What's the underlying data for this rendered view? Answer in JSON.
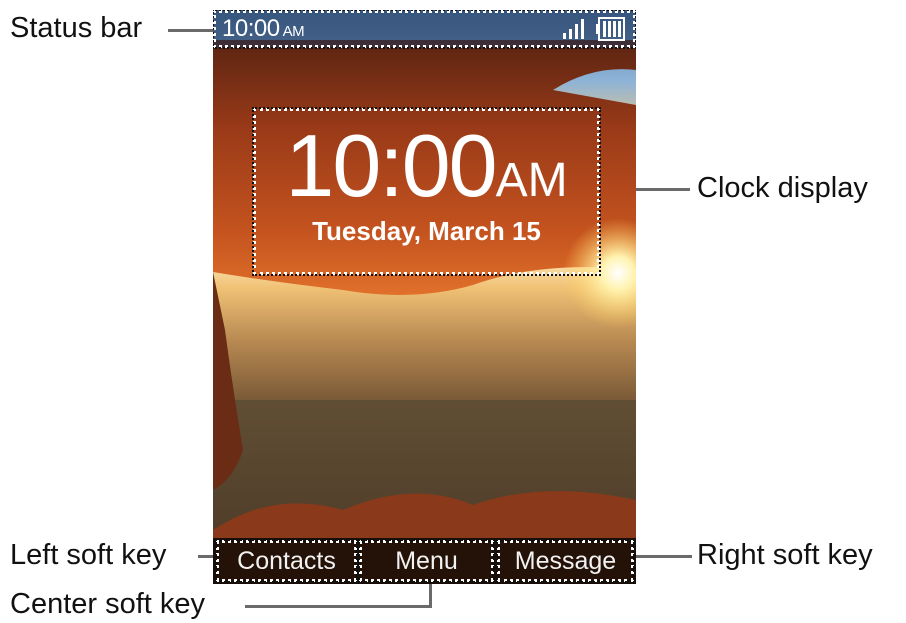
{
  "callouts": {
    "status_bar": "Status bar",
    "clock_display": "Clock display",
    "left_soft_key": "Left soft key",
    "right_soft_key": "Right soft key",
    "center_soft_key": "Center soft key"
  },
  "status_bar": {
    "time": "10:00",
    "ampm": "AM",
    "icons": [
      "signal-strength-icon",
      "battery-icon"
    ]
  },
  "clock": {
    "time": "10:00",
    "ampm": "AM",
    "date": "Tuesday, March 15"
  },
  "softkeys": {
    "left": "Contacts",
    "center": "Menu",
    "right": "Message"
  },
  "colors": {
    "text_on_screen": "#ffffff",
    "softkey_background": "#241208",
    "leader_line": "#6a6a6a"
  }
}
